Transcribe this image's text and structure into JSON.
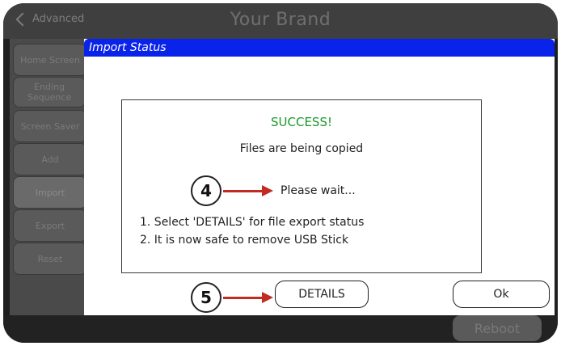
{
  "header": {
    "back_label": "Advanced",
    "brand": "Your Brand"
  },
  "sidebar": {
    "items": [
      {
        "label": "Home Screen"
      },
      {
        "label": "Ending Sequence"
      },
      {
        "label": "Screen Saver"
      },
      {
        "label": "Add"
      },
      {
        "label": "Import"
      },
      {
        "label": "Export"
      },
      {
        "label": "Reset"
      }
    ]
  },
  "dialog": {
    "title": "Import Status",
    "success": "SUCCESS!",
    "copying": "Files are being copied",
    "wait": "Please wait...",
    "steps": [
      "1. Select 'DETAILS' for file export status",
      "2. It is now safe to remove USB Stick"
    ],
    "details_label": "DETAILS",
    "ok_label": "Ok"
  },
  "callouts": {
    "wait_number": "4",
    "details_number": "5"
  },
  "footer": {
    "reboot_label": "Reboot"
  },
  "colors": {
    "header_blue": "#0a23ea",
    "success_green": "#1a9a2a",
    "arrow_red": "#c32a22"
  }
}
